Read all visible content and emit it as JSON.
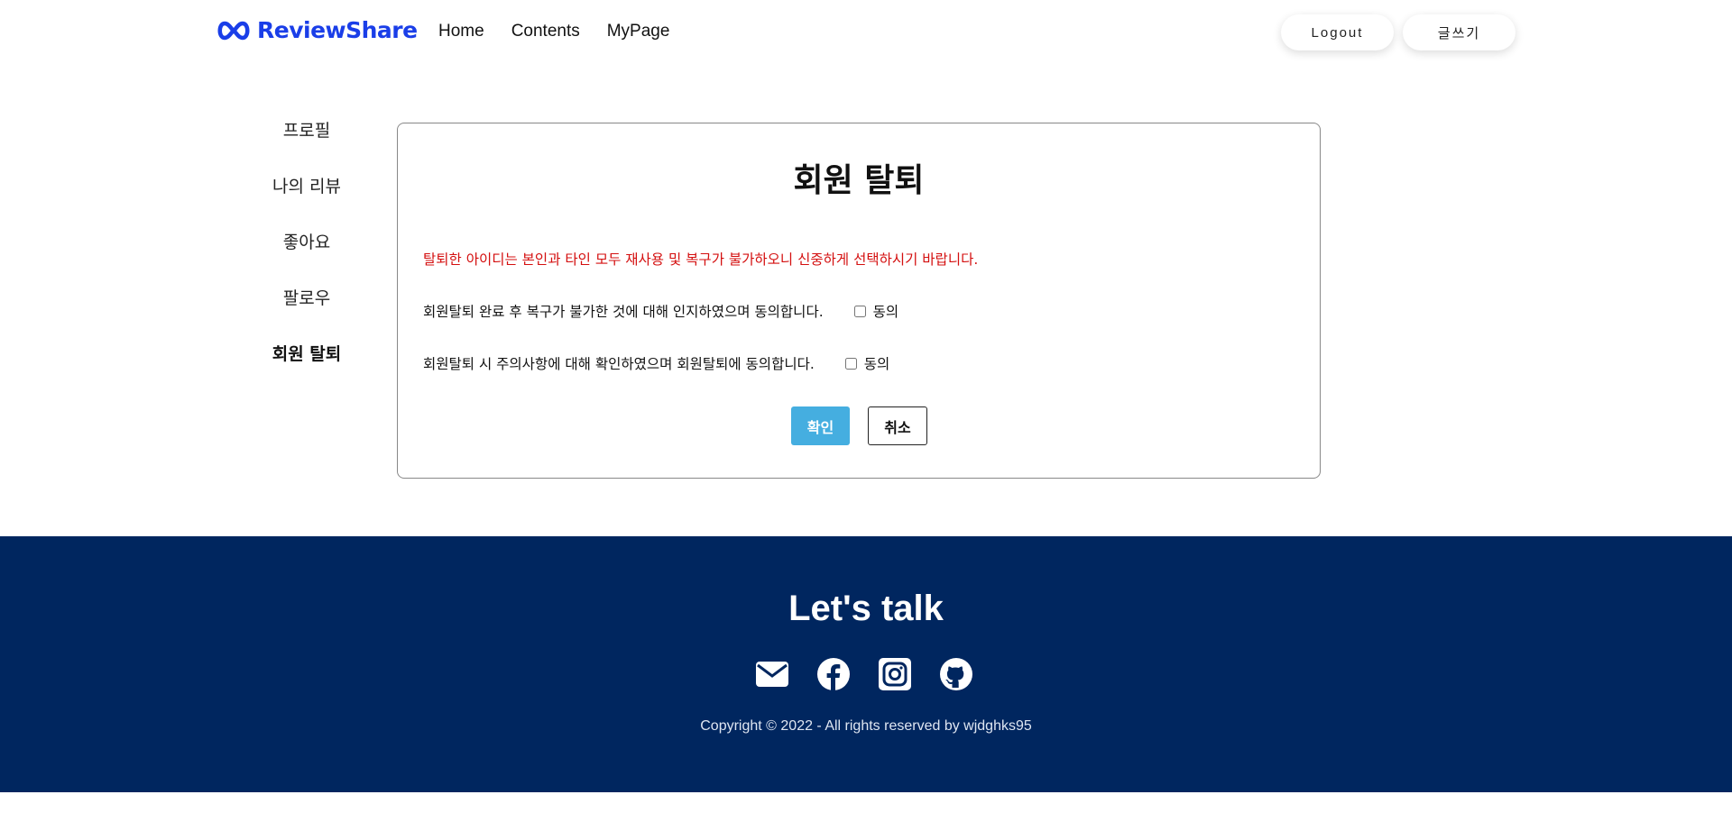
{
  "header": {
    "logo_text": "ReviewShare",
    "logo_icon": "infinity-icon",
    "brand_color": "#1a3ee8",
    "nav": [
      {
        "label": "Home"
      },
      {
        "label": "Contents"
      },
      {
        "label": "MyPage"
      }
    ],
    "logout_label": "Logout",
    "write_label": "글쓰기"
  },
  "sidebar": {
    "items": [
      {
        "label": "프로필"
      },
      {
        "label": "나의 리뷰"
      },
      {
        "label": "좋아요"
      },
      {
        "label": "팔로우"
      },
      {
        "label": "회원 탈퇴",
        "active": true
      }
    ]
  },
  "withdraw": {
    "title": "회원 탈퇴",
    "warning": "탈퇴한 아이디는 본인과 타인 모두 재사용 및 복구가 불가하오니 신중하게 선택하시기 바랍니다.",
    "warning_color": "#d40f0f",
    "agreements": [
      {
        "text": "회원탈퇴 완료 후 복구가 불가한 것에 대해 인지하였으며 동의합니다.",
        "checkbox_label": "동의",
        "checked": false
      },
      {
        "text": "회원탈퇴 시 주의사항에 대해 확인하였으며 회원탈퇴에 동의합니다.",
        "checkbox_label": "동의",
        "checked": false
      }
    ],
    "confirm_label": "확인",
    "cancel_label": "취소",
    "confirm_color": "#45aee0"
  },
  "footer": {
    "title": "Let's talk",
    "background_color": "#00265f",
    "socials": [
      {
        "icon": "mail-icon"
      },
      {
        "icon": "facebook-icon"
      },
      {
        "icon": "instagram-icon"
      },
      {
        "icon": "github-icon"
      }
    ],
    "copyright": "Copyright © 2022 - All rights reserved by wjdghks95"
  }
}
